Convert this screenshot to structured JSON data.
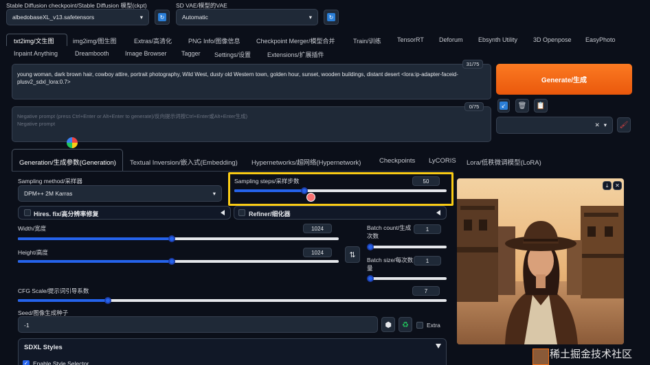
{
  "top": {
    "checkpoint_label": "Stable Diffusion checkpoint/Stable Diffusion 模型(ckpt)",
    "checkpoint_value": "albedobaseXL_v13.safetensors",
    "vae_label": "SD VAE/模型的VAE",
    "vae_value": "Automatic"
  },
  "tabs_row1": [
    "txt2img/文生图",
    "img2img/图生图",
    "Extras/高清化",
    "PNG Info/图像信息",
    "Checkpoint Merger/模型合并",
    "Train/训练",
    "TensorRT",
    "Deforum",
    "Ebsynth Utility",
    "3D Openpose",
    "EasyPhoto"
  ],
  "tabs_row2": [
    "Inpaint Anything",
    "Dreambooth",
    "Image Browser",
    "Tagger",
    "Settings/设置",
    "Extensions/扩展插件"
  ],
  "prompt": {
    "text": "young woman, dark brown hair, cowboy attire, portrait photography, Wild West, dusty old Western town, golden hour, sunset, wooden buildings, distant desert <lora:ip-adapter-faceid-plusv2_sdxl_lora:0.7>",
    "count": "31/75"
  },
  "negative": {
    "placeholder": "Negative prompt (press Ctrl+Enter or Alt+Enter to generate)/反向提示词按Ctrl+Enter或Alt+Enter生成)\nNegative prompt",
    "count": "0/75"
  },
  "generate_label": "Generate/生成",
  "subtabs": [
    "Generation/生成参数(Generation)",
    "Textual Inversion/嵌入式(Embedding)",
    "Hypernetworks/超网络(Hypernetwork)",
    "Checkpoints",
    "LyCORIS",
    "Lora/低秩微调模型(LoRA)"
  ],
  "sampling_method": {
    "label": "Sampling method/采样器",
    "value": "DPM++ 2M Karras"
  },
  "sampling_steps": {
    "label": "Sampling steps/采样步数",
    "value": "50",
    "fraction": 0.33
  },
  "hires_fix": "Hires. fix/高分辨率修复",
  "refiner": "Refiner/细化器",
  "width": {
    "label": "Width/宽度",
    "value": "1024",
    "fraction": 0.48
  },
  "height": {
    "label": "Height/高度",
    "value": "1024",
    "fraction": 0.48
  },
  "batch_count": {
    "label": "Batch count/生成次数",
    "value": "1",
    "fraction": 0.0
  },
  "batch_size": {
    "label": "Batch size/每次数量",
    "value": "1",
    "fraction": 0.0
  },
  "cfg": {
    "label": "CFG Scale/提示词引导系数",
    "value": "7",
    "fraction": 0.21
  },
  "seed": {
    "label": "Seed/图像生成种子",
    "value": "-1",
    "extra_label": "Extra"
  },
  "sdxl_styles": "SDXL Styles",
  "enable_style": "Enable Style Selector",
  "watermark": "稀土掘金技术社区",
  "colors": {
    "accent": "#f97316",
    "highlight": "#facc15",
    "slider": "#2563eb"
  }
}
